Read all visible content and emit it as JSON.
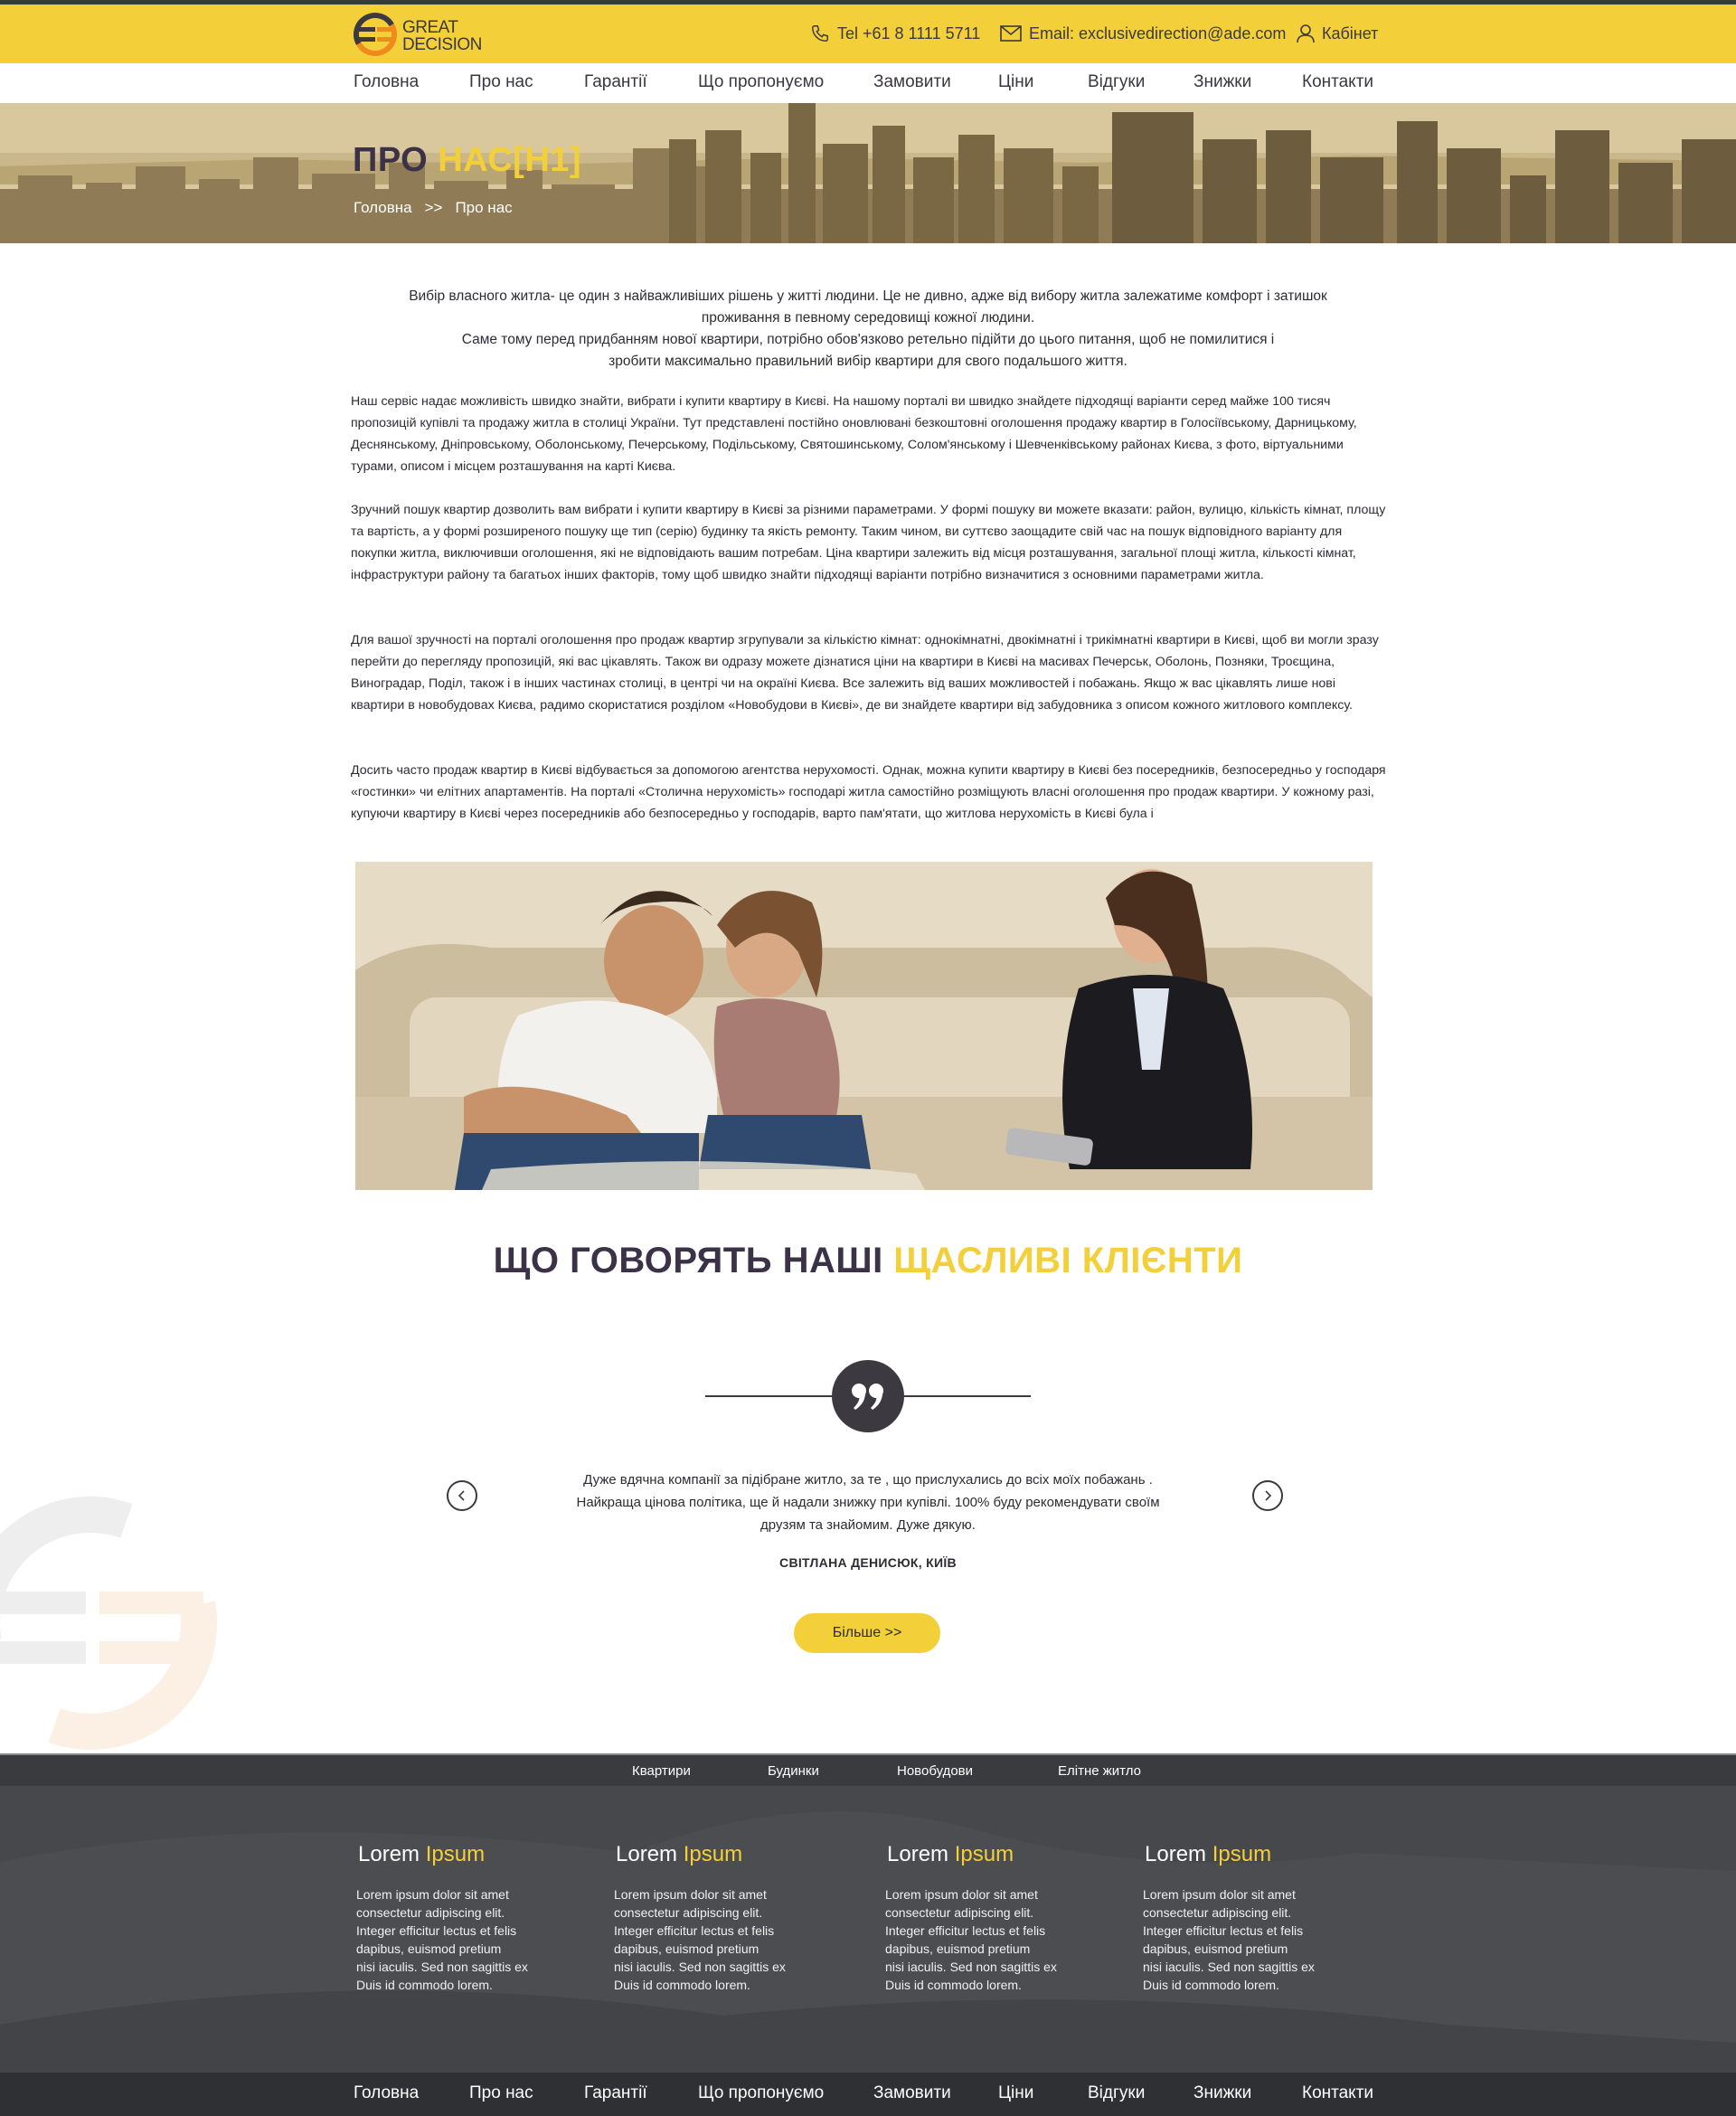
{
  "brand": {
    "name_line1": "GREAT",
    "name_line2": "DECISION",
    "colors": {
      "accent": "#f3d03a",
      "dark": "#3c3247",
      "footer": "#47484b"
    }
  },
  "contacts": {
    "phone": "Tel +61 8 1111 5711",
    "email": "Email: exclusivedirection@ade.com",
    "cabinet": "Кабінет"
  },
  "nav": [
    "Головна",
    "Про нас",
    "Гарантії",
    "Що пропонуємо",
    "Замовити",
    "Ціни",
    "Відгуки",
    "Знижки",
    "Контакти"
  ],
  "hero": {
    "title_main": "ПРО ",
    "title_highlight": "НАС[H1]",
    "breadcrumb": {
      "home": "Головна",
      "separator": ">>",
      "current": "Про нас"
    }
  },
  "intro": [
    "Вибір власного житла- це один з найважливіших рішень у житті людини. Це не дивно, адже від вибору житла залежатиме комфорт і затишок",
    "проживання в певному середовищі кожної людини.",
    "Саме тому перед придбанням нової квартири, потрібно обов'язково ретельно підійти до цього питання, щоб не помилитися і",
    "зробити максимально правильний вибір квартири для свого подальшого життя."
  ],
  "paragraphs": [
    " Наш сервіс надає можливість швидко знайти, вибрати і купити квартиру в Києві. На нашому порталі ви швидко знайдете підходящі варіанти серед майже 100 тисяч пропозицій купівлі та продажу житла в столиці України. Тут представлені постійно оновлювані безкоштовні оголошення продажу квартир в Голосіївському, Дарницькому, Деснянському, Дніпровському, Оболонському, Печерському, Подільському, Святошинському, Солом'янському і Шевченківському районах Києва, з фото, віртуальними турами, описом і місцем розташування на карті Києва.",
    "Зручний пошук квартир дозволить вам вибрати і купити квартиру в Києві за різними параметрами. У формі пошуку ви можете вказати: район, вулицю, кількість кімнат, площу та вартість, а у формі розширеного пошуку ще тип (серію) будинку та якість ремонту. Таким чином, ви суттєво заощадите свій час на пошук відповідного варіанту для покупки житла, виключивши оголошення, які не відповідають вашим потребам. Ціна квартири залежить від місця розташування, загальної площі житла, кількості кімнат, інфраструктури району та багатьох інших факторів, тому щоб швидко знайти підходящі варіанти потрібно визначитися з основними параметрами житла.",
    "Для вашої зручності на порталі оголошення про продаж квартир згрупували за кількістю кімнат: однокімнатні, двокімнатні і трикімнатні квартири в Києві, щоб ви могли зразу перейти до перегляду пропозицій, які вас цікавлять. Також ви одразу можете дізнатися ціни на квартири в Києві на масивах Печерськ, Оболонь, Позняки, Троєщина, Виноградар, Поділ, також і в інших частинах столиці, в центрі чи на окраїні Києва. Все залежить від ваших можливостей і побажань. Якщо ж вас цікавлять лише нові квартири в новобудовах Києва, радимо скористатися розділом «Новобудови в Києві», де ви знайдете квартири від забудовника з описом кожного житлового комплексу.",
    "Досить часто продаж квартир в Києві відбувається за допомогою агентства нерухомості. Однак, можна купити квартиру в Києві без посередників, безпосередньо у господаря «гостинки» чи елітних апартаментів. На порталі «Столична нерухомість» господарі житла самостійно розміщують власні оголошення про продаж квартири. У кожному разі, купуючи квартиру в Києві через посередників або безпосередньо у господарів, варто пам'ятати, що житлова нерухомість в Києві була і"
  ],
  "reviews": {
    "title_main": "ЩО ГОВОРЯТЬ НАШІ ",
    "title_highlight": "ЩАСЛИВІ КЛІЄНТИ",
    "text_lines": [
      "Дуже вдячна компанії за підібране житло, за те , що прислухались до всіх моїх побажань .",
      "Найкраща цінова політика, ще й надали  знижку при купівлі. 100% буду рекомендувати своїм",
      "друзям та знайомим. Дуже дякую."
    ],
    "author": "СВІТЛАНА ДЕНИСЮК, КИЇВ",
    "more": "Більше >>"
  },
  "footer": {
    "categories": [
      "Квартири",
      "Будинки",
      "Новобудови",
      "Елітне житло"
    ],
    "columns": [
      {
        "title_main": "Lorem ",
        "title_highlight": "Ipsum",
        "lines": [
          "Lorem ipsum dolor sit amet",
          "consectetur adipiscing elit.",
          "Integer efficitur lectus et felis",
          "dapibus, euismod pretium",
          "nisi iaculis. Sed non sagittis ex",
          "Duis id commodo lorem."
        ]
      },
      {
        "title_main": "Lorem ",
        "title_highlight": "Ipsum",
        "lines": [
          "Lorem ipsum dolor sit amet",
          "consectetur adipiscing elit.",
          "Integer efficitur lectus et felis",
          "dapibus, euismod pretium",
          "nisi iaculis. Sed non sagittis ex",
          "Duis id commodo lorem."
        ]
      },
      {
        "title_main": "Lorem ",
        "title_highlight": "Ipsum",
        "lines": [
          "Lorem ipsum dolor sit amet",
          "consectetur adipiscing elit.",
          "Integer efficitur lectus et felis",
          "dapibus, euismod pretium",
          "nisi iaculis. Sed non sagittis ex",
          "Duis id commodo lorem."
        ]
      },
      {
        "title_main": "Lorem ",
        "title_highlight": "Ipsum",
        "lines": [
          "Lorem ipsum dolor sit amet",
          "consectetur adipiscing elit.",
          "Integer efficitur lectus et felis",
          "dapibus, euismod pretium",
          "nisi iaculis. Sed non sagittis ex",
          "Duis id commodo lorem."
        ]
      }
    ]
  }
}
